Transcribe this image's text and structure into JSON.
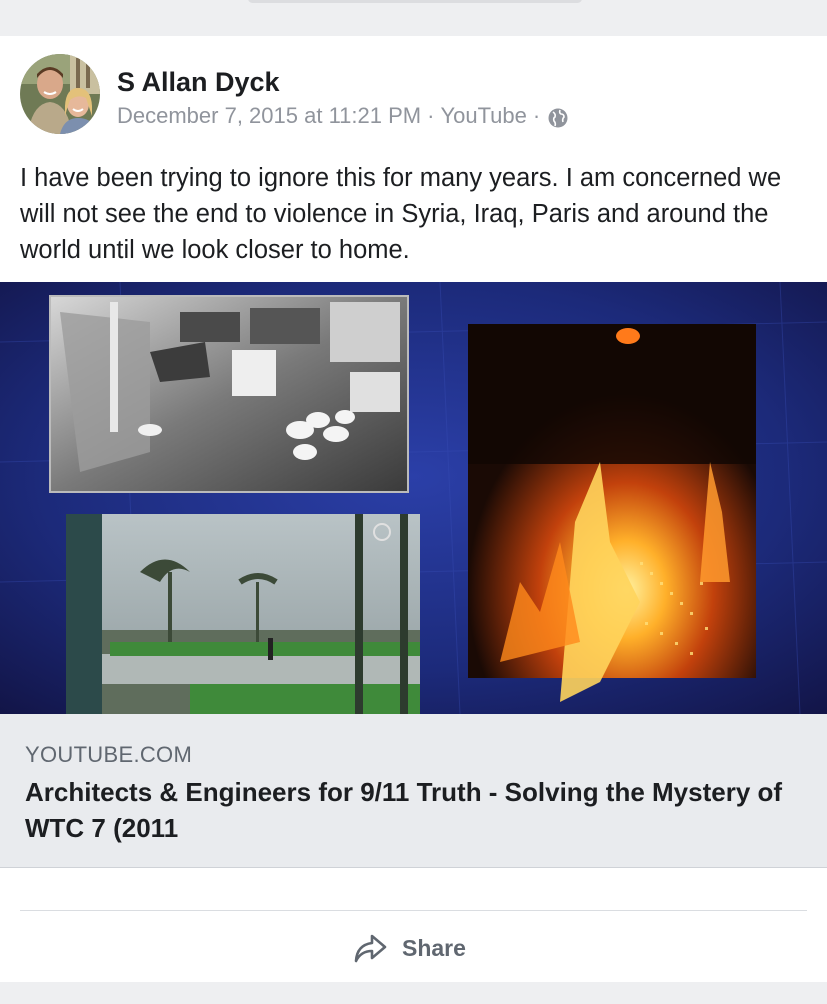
{
  "post": {
    "author": "S Allan Dyck",
    "timestamp": "December 7, 2015 at 11:21 PM",
    "source": "YouTube",
    "separator": "·",
    "privacy_icon": "globe-icon",
    "text": "I have been trying to ignore this for many years. I am concerned we will not see the end to violence in Syria, Iraq, Paris and around the world until we look closer to home."
  },
  "link_preview": {
    "domain": "YOUTUBE.COM",
    "title": "Architects & Engineers for 9/11 Truth - Solving the Mystery of WTC 7 (2011"
  },
  "actions": {
    "share_label": "Share",
    "share_icon": "share-arrow-icon"
  },
  "colors": {
    "author": "#1c1e21",
    "meta": "#90949c",
    "link_box_bg": "#e9ebee",
    "media_bg": "#1b1f52",
    "action_text": "#606770"
  }
}
